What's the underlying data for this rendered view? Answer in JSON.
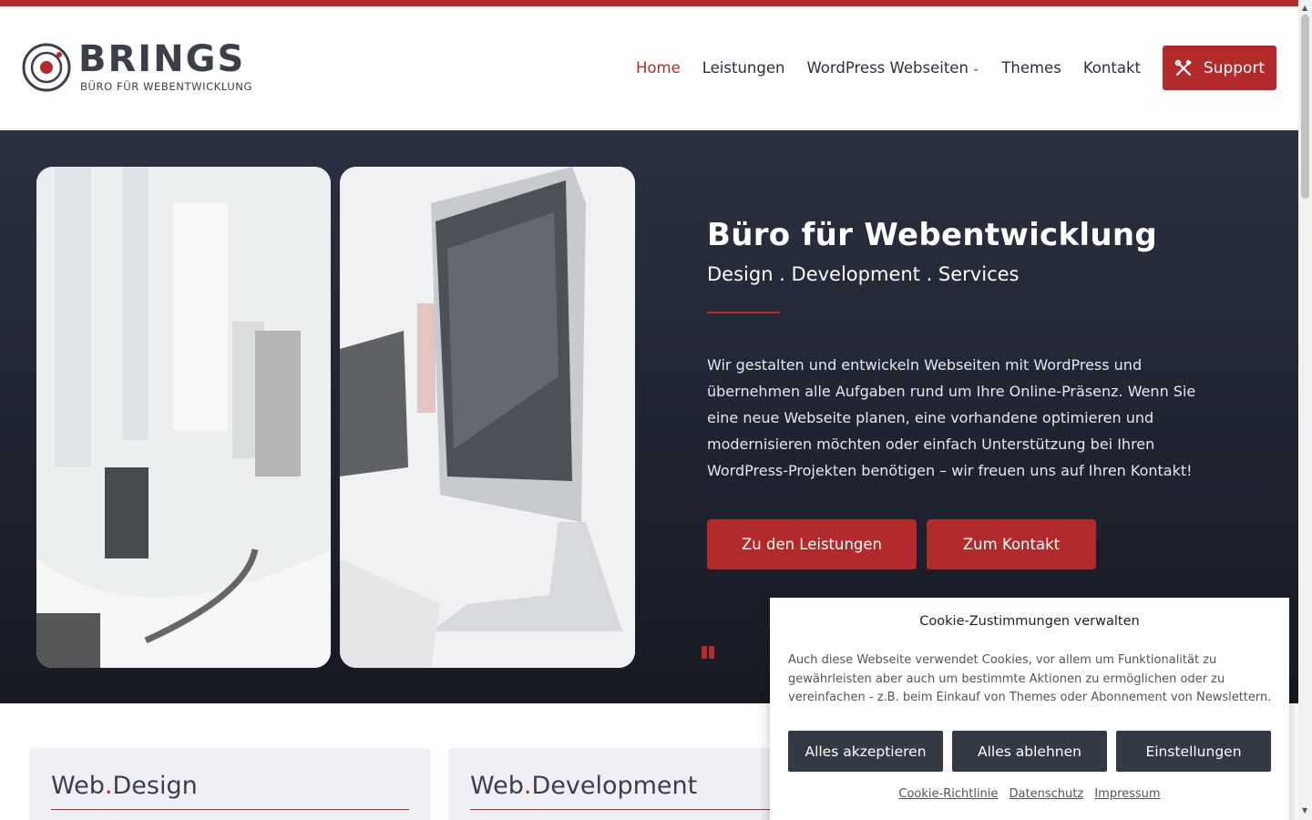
{
  "brand": {
    "name": "BRINGS",
    "tagline": "BÜRO FÜR WEBENTWICKLUNG",
    "accent_color": "#b22a2a",
    "dark_color": "#333945"
  },
  "nav": {
    "items": [
      {
        "label": "Home",
        "active": true
      },
      {
        "label": "Leistungen",
        "active": false
      },
      {
        "label": "WordPress Webseiten",
        "active": false,
        "has_dropdown": true
      },
      {
        "label": "Themes",
        "active": false
      },
      {
        "label": "Kontakt",
        "active": false
      }
    ],
    "support_label": "Support",
    "support_icon": "tools-icon",
    "dropdown_icon": "⌄"
  },
  "hero": {
    "title": "Büro für Webentwicklung",
    "subtitle": "Design . Development . Services",
    "text": "Wir gestalten und entwickeln Webseiten mit WordPress und übernehmen alle Aufgaben rund um Ihre Online-Präsenz. Wenn Sie eine neue Webseite planen, eine vorhandene optimieren und modernisieren möchten oder einfach Unterstützung bei Ihren WordPress-Projekten benötigen – wir freuen uns auf Ihren Kontakt!",
    "buttons": {
      "services": "Zu den Leistungen",
      "contact": "Zum Kontakt"
    },
    "pause_icon": "pause-icon"
  },
  "cards": [
    {
      "title_a": "Web",
      "dot": ".",
      "title_b": "Design"
    },
    {
      "title_a": "Web",
      "dot": ".",
      "title_b": "Development"
    }
  ],
  "cookie": {
    "title": "Cookie-Zustimmungen verwalten",
    "text": "Auch diese Webseite verwendet Cookies, vor allem um Funktionalität zu gewährleisten aber auch um bestimmte Aktionen zu ermöglichen oder zu vereinfachen - z.B. beim Einkauf von Themes oder Abonnement von Newslettern.",
    "accept": "Alles akzeptieren",
    "reject": "Alles ablehnen",
    "settings": "Einstellungen",
    "links": [
      "Cookie-Richtlinie",
      "Datenschutz",
      "Impressum"
    ]
  }
}
